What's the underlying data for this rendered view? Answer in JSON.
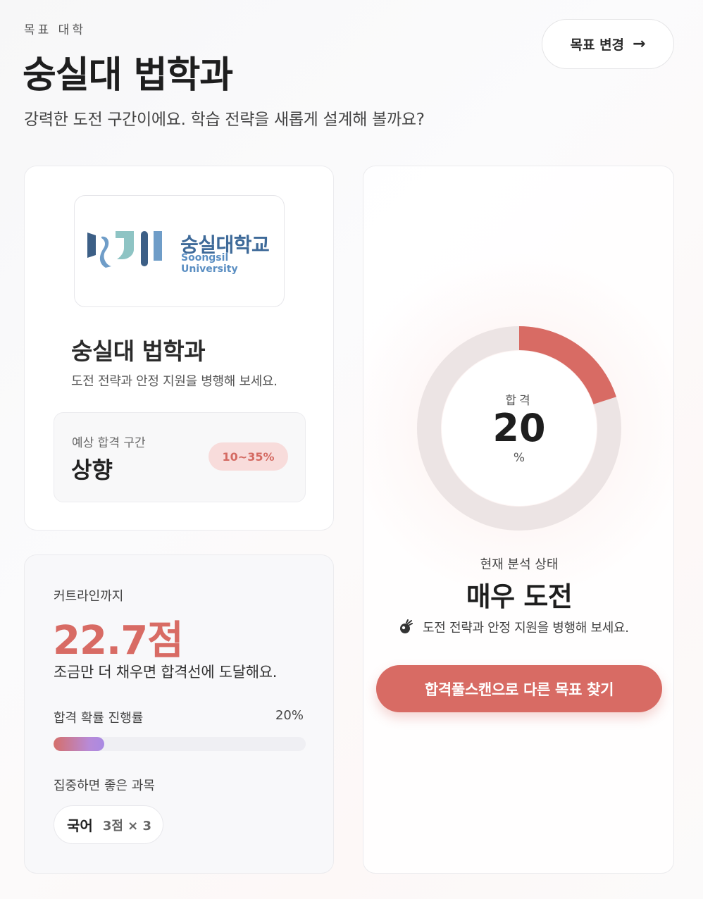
{
  "header": {
    "eyebrow": "목표 대학",
    "title": "숭실대 법학과",
    "subtitle": "강력한 도전 구간이에요. 학습 전략을 새롭게 설계해 볼까요?",
    "change_button_label": "목표 변경",
    "change_button_icon": "arrow-right-icon"
  },
  "school_card": {
    "logo": {
      "ko": "숭실대학교",
      "en": "Soongsil University"
    },
    "name": "숭실대 법학과",
    "description": "도전 전략과 안정 지원을 병행해 보세요.",
    "range": {
      "label": "예상 합격 구간",
      "value": "상향",
      "badge": "10~35%"
    }
  },
  "gap_card": {
    "label": "커트라인까지",
    "value": "22.7점",
    "description": "조금만 더 채우면 합격선에 도달해요.",
    "progress": {
      "label": "합격 확률 진행률",
      "percent_text": "20%",
      "value": 0.2
    },
    "focus_label": "집중하면 좋은 과목",
    "subjects": [
      {
        "name": "국어",
        "weight": "3점 × 3"
      }
    ]
  },
  "chart_card": {
    "donut": {
      "label": "합격",
      "value": "20",
      "unit": "%",
      "percent": 20
    },
    "status_label": "현재 분석 상태",
    "status_value": "매우 도전",
    "tip_icon": "comet-icon",
    "tip": "도전 전략과 안정 지원을 병행해 보세요.",
    "cta_label": "합격풀스캔으로 다른 목표 찾기"
  },
  "colors": {
    "accent": "#d86b64",
    "badge_bg": "#f8dcdb",
    "donut_track": "#ece4e4",
    "progress_start": "#d56f6a",
    "progress_end": "#a98ae3"
  }
}
